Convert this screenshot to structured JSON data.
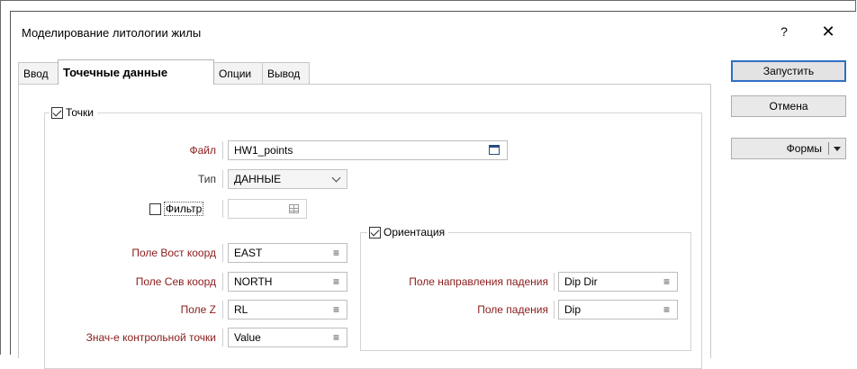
{
  "window": {
    "title": "Моделирование литологии жилы",
    "help_label": "?",
    "close_label": "✕"
  },
  "tabs": [
    {
      "label": "Ввод",
      "active": false
    },
    {
      "label": "Точечные данные",
      "active": true
    },
    {
      "label": "Опции",
      "active": false
    },
    {
      "label": "Вывод",
      "active": false
    }
  ],
  "points_group": {
    "label": "Точки",
    "checked": true,
    "file": {
      "label": "Файл",
      "value": "HW1_points"
    },
    "type": {
      "label": "Тип",
      "value": "ДАННЫЕ"
    },
    "filter": {
      "label": "Фильтр",
      "checked": false,
      "value": ""
    },
    "east_field": {
      "label": "Поле Вост коорд",
      "value": "EAST"
    },
    "north_field": {
      "label": "Поле Сев коорд",
      "value": "NORTH"
    },
    "z_field": {
      "label": "Поле Z",
      "value": "RL"
    },
    "control_value": {
      "label": "Знач-е контрольной точки",
      "value": "Value"
    },
    "field_icon": "≡"
  },
  "orientation_group": {
    "label": "Ориентация",
    "checked": true,
    "dip_direction": {
      "label": "Поле направления падения",
      "value": "Dip Dir"
    },
    "dip": {
      "label": "Поле падения",
      "value": "Dip"
    }
  },
  "buttons": {
    "run": "Запустить",
    "cancel": "Отмена",
    "forms": "Формы"
  },
  "colors": {
    "required_label": "#8b1a1a",
    "primary_border": "#2f6fc4"
  }
}
